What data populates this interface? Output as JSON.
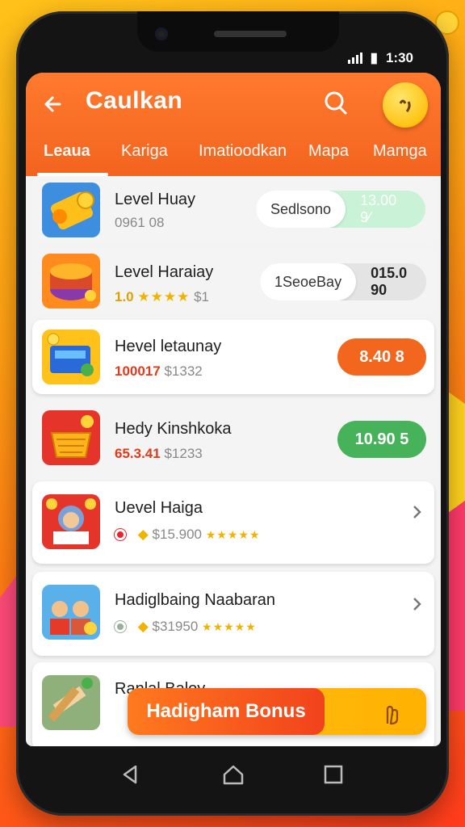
{
  "status_bar": {
    "time": "1:30"
  },
  "app_bar": {
    "title": "Caulkan",
    "tabs": [
      {
        "label": "Leaua",
        "active": true
      },
      {
        "label": "Kariga",
        "active": false
      },
      {
        "label": "Imatioodkan",
        "active": false
      },
      {
        "label": "Mapa",
        "active": false
      },
      {
        "label": "Mamga",
        "active": false
      }
    ]
  },
  "items": [
    {
      "name": "Level Huay",
      "sub": "0961 08",
      "pill_label": "Sedlsono",
      "pill_value": "13.00 9⁄",
      "pill_color": "#c9f2d6"
    },
    {
      "name": "Level Haraiay",
      "sub_highlight": "1.0",
      "stars": "★★★★",
      "sub_price": "$1",
      "pill_label": "1SeoeBay",
      "pill_value": "015.0 90",
      "pill_color": "#e4e4e4"
    },
    {
      "name": "Hevel letaunay",
      "sub_highlight": "100017",
      "sub_price": "$1332",
      "button": "8.40 8",
      "button_color": "#f2661e"
    },
    {
      "name": "Hedy Kinshkoka",
      "sub_highlight": "65.3.41",
      "sub_price": "$1233",
      "button": "10.90 5",
      "button_color": "#46b35a"
    },
    {
      "name": "Uevel Haiga",
      "sub_price": "$15.900",
      "stars": "★★★★★",
      "dot_color": "#e8232a"
    },
    {
      "name": "Hadiglbaing Naabaran",
      "sub_price": "$31950",
      "stars": "★★★★★",
      "dot_color": "#9aaf9a"
    },
    {
      "name": "Ranlal Baloy"
    }
  ],
  "bonus": {
    "label": "Hadigham Bonus"
  },
  "colors": {
    "primary": "#f3641f",
    "accent": "#ffc21a",
    "green": "#46b35a"
  },
  "icons": [
    "back-arrow-icon",
    "search-icon",
    "emoji-face-icon",
    "chevron-right-icon",
    "hand-icon",
    "nav-back-icon",
    "nav-home-icon",
    "nav-recents-icon"
  ]
}
